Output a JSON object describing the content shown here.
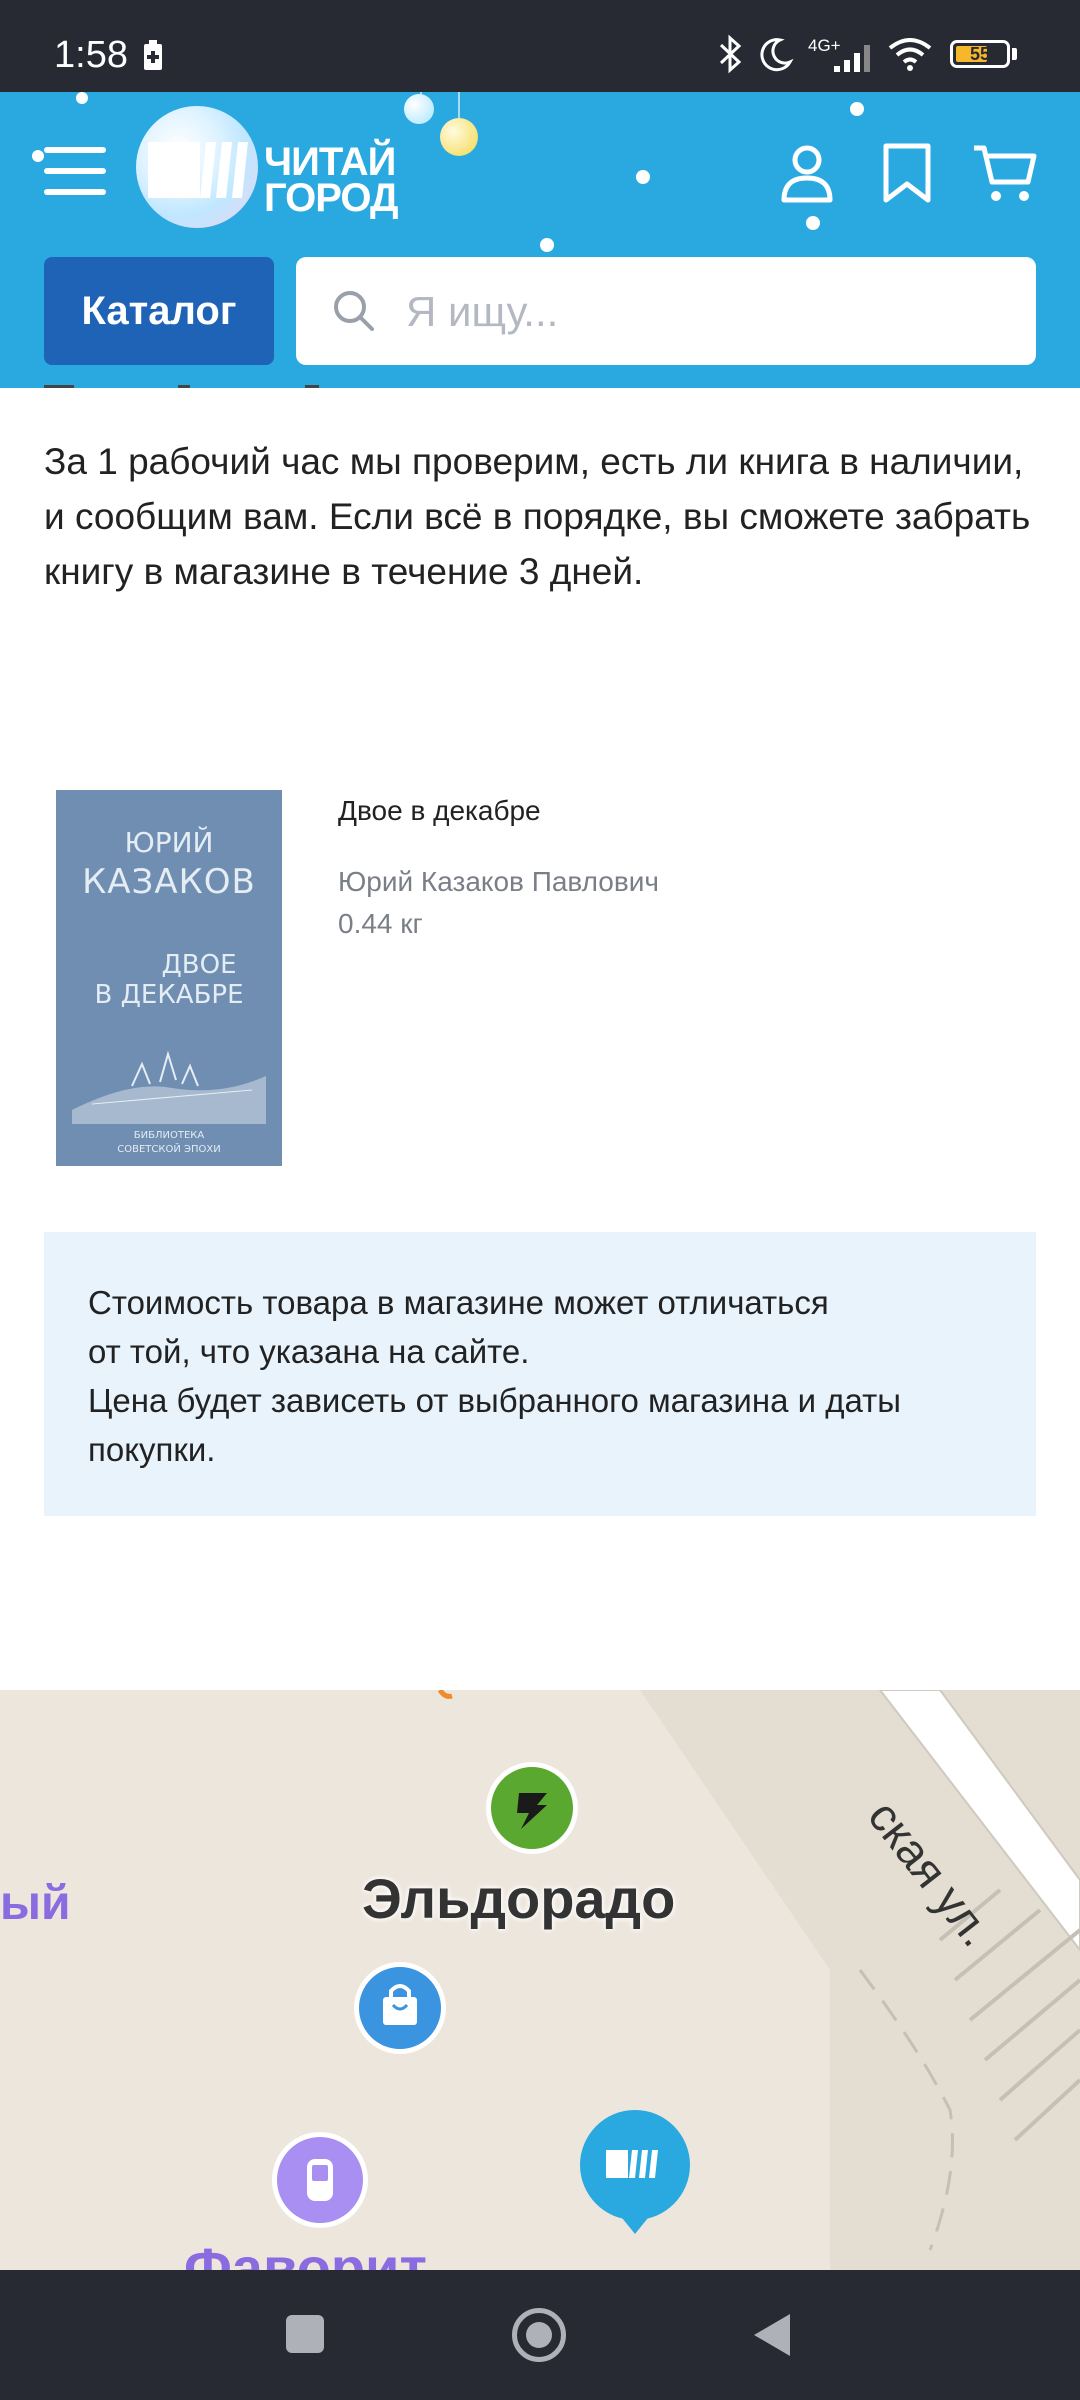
{
  "status_bar": {
    "time": "1:58",
    "network": "4G+",
    "battery": "55"
  },
  "header": {
    "logo_line1": "ЧИТАЙ",
    "logo_line2": "ГОРОД",
    "catalog_label": "Каталог",
    "search_placeholder": "Я ищу..."
  },
  "main": {
    "info_text": "За 1 рабочий час мы проверим, есть ли книга в наличии, и сообщим вам. Если всё в порядке, вы сможете забрать книгу в магазине в течение 3 дней.",
    "book": {
      "title": "Двое в декабре",
      "author": "Юрий Казаков Павлович",
      "weight": "0.44 кг",
      "cover_author_first": "ЮРИЙ",
      "cover_author_last": "КАЗАКОВ",
      "cover_title_line1": "ДВОЕ",
      "cover_title_line2": "В ДЕКАБРЕ",
      "cover_series_line1": "БИБЛИОТЕКА",
      "cover_series_line2": "СОВЕТСКОЙ ЭПОХИ"
    },
    "notice_line1": "Стоимость товара в магазине может отличаться",
    "notice_line2": "от той, что указана на сайте.",
    "notice_line3": "Цена будет зависеть от выбранного магазина и даты покупки."
  },
  "map": {
    "street_label": "ская ул.",
    "place_left": "ый",
    "eldorado_label": "Эльдорадо",
    "favorit_label": "Фаворит"
  },
  "colors": {
    "header_bg": "#2aa9e0",
    "catalog_bg": "#1f63b6",
    "notice_bg": "#e8f3fc",
    "system_bar": "#272a33",
    "battery": "#f6b82a",
    "eldorado": "#5aa830",
    "favorit": "#a98ff2",
    "pin": "#2aa9e0"
  }
}
